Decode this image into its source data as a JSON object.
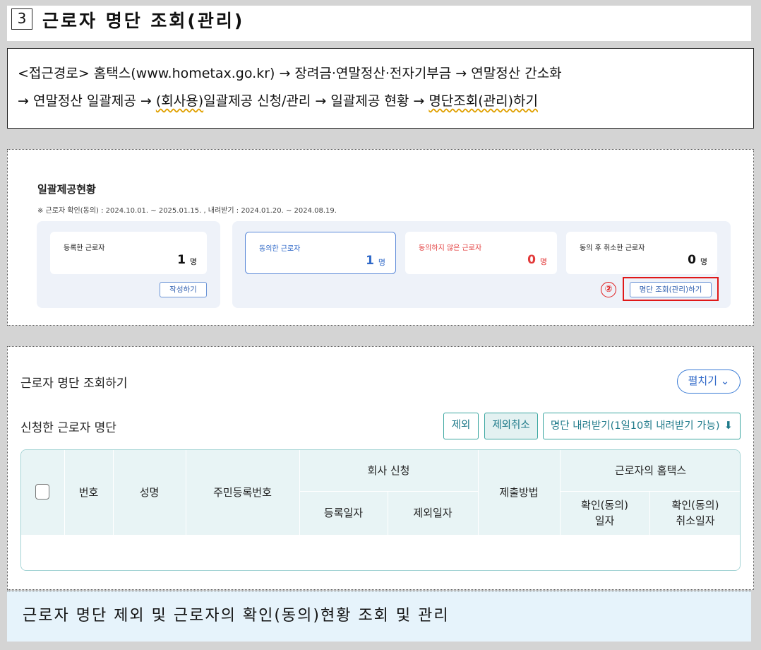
{
  "section": {
    "number": "3",
    "title": "근로자 명단 조회(관리)"
  },
  "route": {
    "line1": {
      "prefix": "<접근경로>  홈택스(www.hometax.go.kr) → 장려금·연말정산·전자기부금 → 연말정산   간소화"
    },
    "line2": {
      "a": "→ 연말정산  일괄제공 → ",
      "b": "(회사용)",
      "c": "일괄제공  신청/관리  →  일괄제공  현황  →  ",
      "d": "명단조회(관리)하기"
    }
  },
  "status_card": {
    "title": "일괄제공현황",
    "note": "※ 근로자 확인(동의) : 2024.10.01. ~ 2025.01.15. , 내려받기 : 2024.01.20. ~ 2024.08.19.",
    "registered": {
      "label": "등록한 근로자",
      "value": "1",
      "unit": "명"
    },
    "write_button": "작성하기",
    "agreed": {
      "label": "동의한 근로자",
      "value": "1",
      "unit": "명"
    },
    "not_agreed": {
      "label": "동의하지 않은 근로자",
      "value": "0",
      "unit": "명"
    },
    "cancelled": {
      "label": "동의 후 취소한 근로자",
      "value": "0",
      "unit": "명"
    },
    "manage_button": "명단 조회(관리)하기",
    "step_marker": "②"
  },
  "list_card": {
    "title": "근로자 명단 조회하기",
    "expand_button": "펼치기",
    "subtitle": "신청한 근로자 명단",
    "exclude_button": "제외",
    "cancel_exclude_button": "제외취소",
    "download_button": "명단 내려받기(1일10회 내려받기 가능)",
    "columns": {
      "number": "번호",
      "name": "성명",
      "rrn": "주민등록번호",
      "company_request": "회사 신청",
      "registered_date": "등록일자",
      "excluded_date": "제외일자",
      "submit_method": "제출방법",
      "employee_hometax": "근로자의 홈택스",
      "confirm_date_1": "확인(동의)",
      "confirm_date_2": "일자",
      "cancel_date_1": "확인(동의)",
      "cancel_date_2": "취소일자"
    }
  },
  "footer": {
    "caption": "근로자 명단 제외 및 근로자의 확인(동의)현황 조회 및 관리"
  },
  "colors": {
    "accent_blue": "#2f68c8",
    "alert_red": "#e23a3a",
    "teal": "#1f7a8a",
    "footer_bg": "#e6f3fb"
  }
}
